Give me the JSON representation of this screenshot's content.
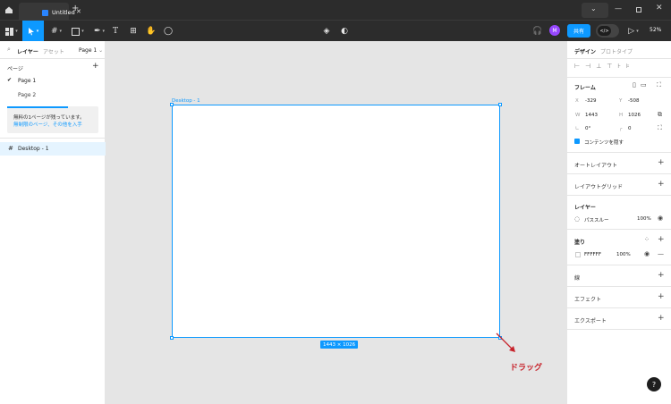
{
  "titlebar": {
    "tab_title": "Untitled",
    "icons": [
      "home-icon",
      "figma-file-icon",
      "close-icon",
      "add-tab-icon",
      "menu-chevron-icon",
      "minimize-icon",
      "maximize-icon",
      "window-close-icon"
    ]
  },
  "toolbar": {
    "tools": [
      "main-menu",
      "move-tool",
      "frame-tool",
      "shape-tool",
      "pen-tool",
      "text-tool",
      "resources-tool",
      "hand-tool",
      "comment-tool"
    ],
    "share_label": "共有",
    "avatar_initial": "M",
    "zoom": "52%",
    "accent": "#0d99ff"
  },
  "left_panel": {
    "tab_layers": "レイヤー",
    "tab_assets": "アセット",
    "page_selector": "Page 1",
    "pages_header": "ページ",
    "pages": [
      "Page 1",
      "Page 2"
    ],
    "notice_line1": "無料の1ページが残っています。",
    "notice_link": "無制限のページ、その他を入手",
    "layers": [
      {
        "name": "Desktop - 1",
        "icon": "frame-icon"
      }
    ]
  },
  "canvas": {
    "frame_name": "Desktop - 1",
    "dimensions": "1443 × 1026",
    "drag_label": "ドラッグ",
    "drag_color": "#c7232b"
  },
  "right_panel": {
    "tab_design": "デザイン",
    "tab_prototype": "プロトタイプ",
    "frame_header": "フレーム",
    "x_label": "X",
    "x_value": "-329",
    "y_label": "Y",
    "y_value": "-508",
    "w_label": "W",
    "w_value": "1443",
    "h_label": "H",
    "h_value": "1026",
    "rotation": "0°",
    "radius": "0",
    "clip_content": "コンテンツを隠す",
    "auto_layout": "オートレイアウト",
    "layout_grid": "レイアウトグリッド",
    "layer_header": "レイヤー",
    "blend_mode": "パススルー",
    "layer_opacity": "100%",
    "fill_header": "塗り",
    "fill_hex": "FFFFFF",
    "fill_opacity": "100%",
    "stroke_header": "線",
    "effects_header": "エフェクト",
    "export_header": "エクスポート"
  },
  "help_label": "?"
}
